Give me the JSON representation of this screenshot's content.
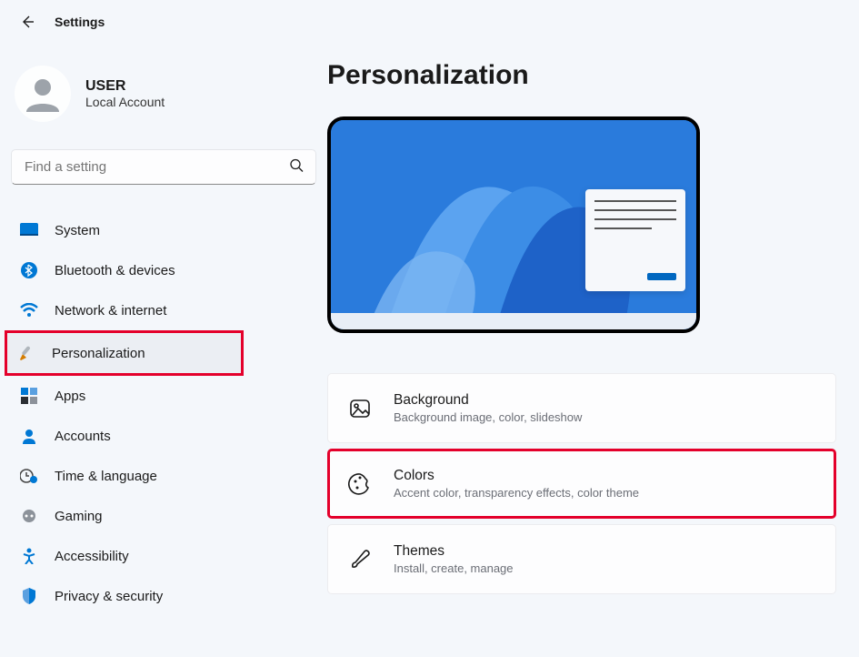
{
  "header": {
    "title": "Settings"
  },
  "user": {
    "name": "USER",
    "account_type": "Local Account"
  },
  "search": {
    "placeholder": "Find a setting"
  },
  "sidebar": {
    "items": [
      {
        "label": "System"
      },
      {
        "label": "Bluetooth & devices"
      },
      {
        "label": "Network & internet"
      },
      {
        "label": "Personalization"
      },
      {
        "label": "Apps"
      },
      {
        "label": "Accounts"
      },
      {
        "label": "Time & language"
      },
      {
        "label": "Gaming"
      },
      {
        "label": "Accessibility"
      },
      {
        "label": "Privacy & security"
      }
    ]
  },
  "page": {
    "title": "Personalization"
  },
  "options": [
    {
      "title": "Background",
      "subtitle": "Background image, color, slideshow"
    },
    {
      "title": "Colors",
      "subtitle": "Accent color, transparency effects, color theme"
    },
    {
      "title": "Themes",
      "subtitle": "Install, create, manage"
    }
  ]
}
